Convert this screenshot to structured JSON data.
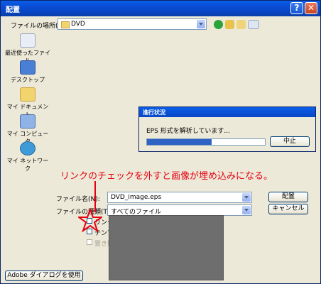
{
  "window": {
    "title": "配置",
    "help_label": "?",
    "close_label": "✕"
  },
  "location": {
    "label": "ファイルの場所(I):",
    "value": "DVD"
  },
  "places": [
    {
      "label": "最近使ったファイル",
      "icon": "recent-icon"
    },
    {
      "label": "デスクトップ",
      "icon": "desktop-icon"
    },
    {
      "label": "マイ ドキュメント",
      "icon": "my-documents-icon"
    },
    {
      "label": "マイ コンピュータ",
      "icon": "my-computer-icon"
    },
    {
      "label": "マイ ネットワーク",
      "icon": "my-network-icon"
    }
  ],
  "filename": {
    "label": "ファイル名(N):",
    "value": "DVD_image.eps"
  },
  "filetype": {
    "label": "ファイルの種類(T):",
    "value": "すべてのファイル"
  },
  "buttons": {
    "place": "配置",
    "cancel": "キャンセル",
    "adobe": "Adobe ダイアログを使用"
  },
  "options": {
    "link": "リンク(L)",
    "template": "テンプレート(E)",
    "replace": "置き換え(C)"
  },
  "progress_dialog": {
    "title": "進行状況",
    "message": "EPS 形式を解析しています...",
    "cancel": "中止",
    "progress": 0.55
  },
  "annotation": "リンクのチェックを外すと画像が埋め込みになる。",
  "colors": {
    "title_blue": "#0846c4",
    "annotation_red": "#e60012",
    "progress_blue": "#2f62c5"
  }
}
